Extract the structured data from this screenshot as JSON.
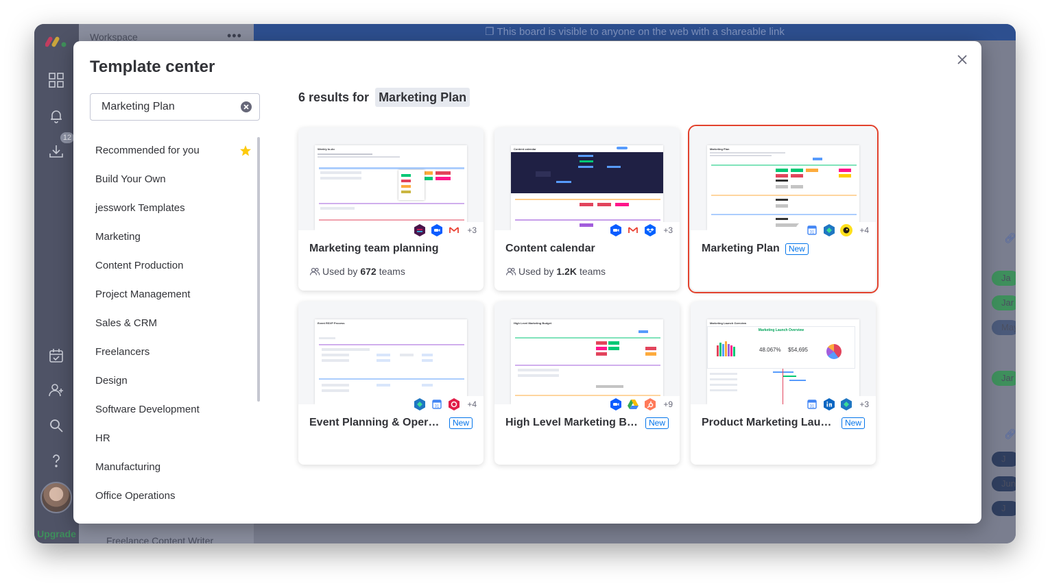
{
  "background": {
    "banner_text": "This board is visible to anyone on the web with a shareable link",
    "workspace_label": "Workspace",
    "workspace_more": "•••",
    "notification_count": "12",
    "upgrade_label": "Upgrade",
    "side_row_text": "Freelance Content Writer",
    "pills": [
      "Ja",
      "Jar",
      "May",
      "Jar",
      "J",
      "Jun",
      "J"
    ]
  },
  "modal": {
    "title": "Template center",
    "search_value": "Marketing Plan",
    "results_prefix": "6 results for",
    "results_query": "Marketing Plan"
  },
  "categories": [
    {
      "label": "Recommended for you",
      "starred": true
    },
    {
      "label": "Build Your Own"
    },
    {
      "label": "jesswork Templates"
    },
    {
      "label": "Marketing"
    },
    {
      "label": "Content Production"
    },
    {
      "label": "Project Management"
    },
    {
      "label": "Sales & CRM"
    },
    {
      "label": "Freelancers"
    },
    {
      "label": "Design"
    },
    {
      "label": "Software Development"
    },
    {
      "label": "HR"
    },
    {
      "label": "Manufacturing"
    },
    {
      "label": "Office Operations"
    }
  ],
  "cards": [
    {
      "title": "Marketing team planning",
      "used_prefix": "Used by",
      "used_count": "672",
      "used_suffix": "teams",
      "more": "+3",
      "icons": [
        "slack-icon",
        "zoom-icon",
        "gmail-icon"
      ]
    },
    {
      "title": "Content calendar",
      "used_prefix": "Used by",
      "used_count": "1.2K",
      "used_suffix": "teams",
      "more": "+3",
      "icons": [
        "zoom-icon",
        "gmail-icon",
        "dropbox-icon"
      ]
    },
    {
      "title": "Marketing Plan",
      "badge": "New",
      "more": "+4",
      "icons": [
        "google-calendar-icon",
        "hex-app-icon",
        "mailchimp-icon"
      ],
      "selected": true
    },
    {
      "title": "Event Planning & Operati...",
      "badge": "New",
      "more": "+4",
      "icons": [
        "hex-app-icon",
        "google-calendar-icon",
        "red-hex-icon"
      ]
    },
    {
      "title": "High Level Marketing Bud...",
      "badge": "New",
      "more": "+9",
      "icons": [
        "zoom-icon",
        "google-drive-icon",
        "hubspot-icon"
      ]
    },
    {
      "title": "Product Marketing Launch",
      "badge": "New",
      "more": "+3",
      "icons": [
        "google-calendar-icon",
        "linkedin-icon",
        "hex-app-icon"
      ]
    }
  ],
  "thumbnails": [
    {
      "title": "Weekly to-do"
    },
    {
      "title": "Content calendar"
    },
    {
      "title": "Marketing Plan"
    },
    {
      "title": "Event RSVP Process"
    },
    {
      "title": "High Level Marketing Budget"
    },
    {
      "title": "Marketing Launch Overview",
      "banner": "Marketing Launch Overview",
      "stat_1": "48.067%",
      "stat_2": "$54,695"
    }
  ],
  "colors": {
    "accent": "#0073ea",
    "selected_outline": "#e2412c",
    "text": "#323338",
    "star": "#fdca0c"
  }
}
